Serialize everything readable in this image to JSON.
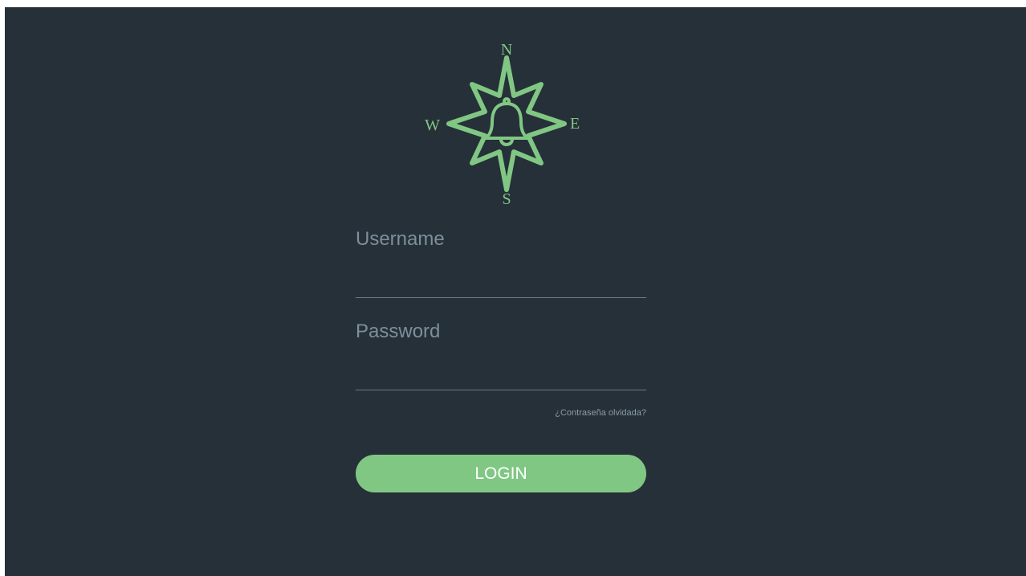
{
  "theme": {
    "background": "#263038",
    "accent": "#81c784",
    "label_color": "#7d8f9b",
    "link_color": "#8a9ba8"
  },
  "logo": {
    "icon": "compass-bell-logo",
    "north": "N",
    "east": "E",
    "south": "S",
    "west": "W"
  },
  "form": {
    "username_label": "Username",
    "username_value": "",
    "password_label": "Password",
    "password_value": "",
    "forgot_password": "¿Contraseña olvidada?",
    "login_label": "LOGIN"
  }
}
